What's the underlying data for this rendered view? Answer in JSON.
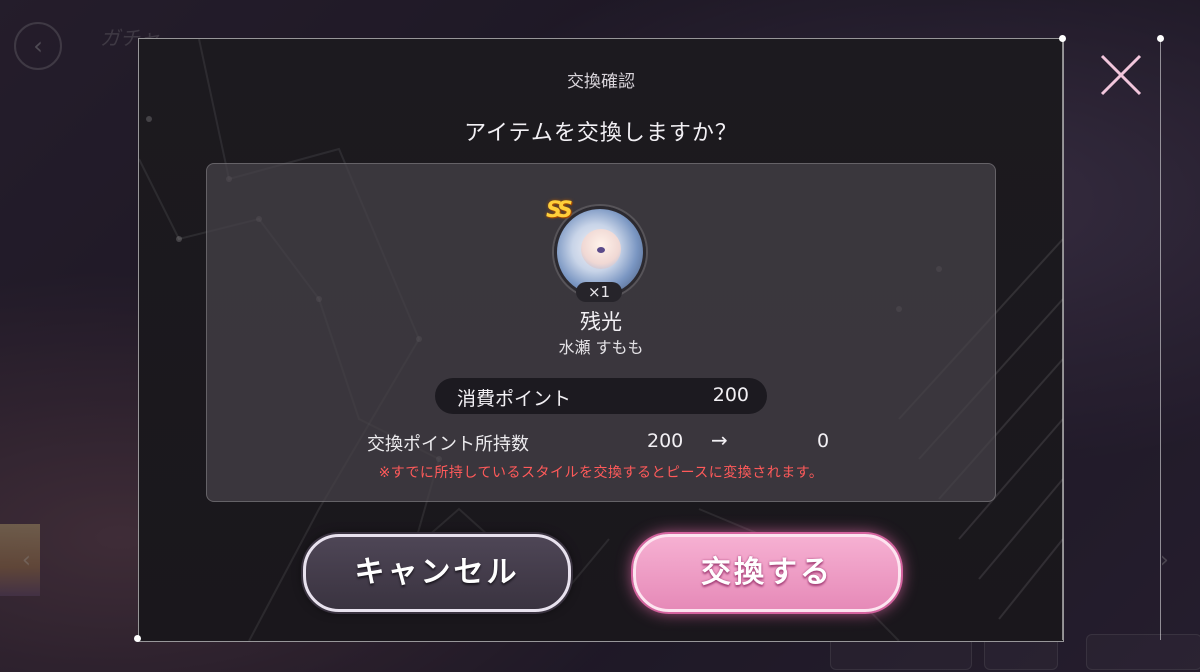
{
  "background": {
    "back_glyph": "‹",
    "screen_title": "ガチャ",
    "nav_left_glyph": "‹",
    "nav_right_glyph": "›"
  },
  "dialog": {
    "title": "交換確認",
    "question": "アイテムを交換しますか？",
    "item": {
      "rarity": "SS",
      "quantity": "×1",
      "name": "残光",
      "character": "水瀬 すもも"
    },
    "cost": {
      "label": "消費ポイント",
      "value": "200"
    },
    "holdings": {
      "label": "交換ポイント所持数",
      "before": "200",
      "arrow": "→",
      "after": "0"
    },
    "notice": "※すでに所持しているスタイルを交換するとピースに変換されます。",
    "buttons": {
      "cancel": "キャンセル",
      "confirm": "交換する"
    },
    "close_icon": "close-icon"
  },
  "colors": {
    "confirm_button": "#e68ab8",
    "cancel_button": "#3a3340",
    "notice_text": "#ff5a5a",
    "rarity_badge": "#ffcf3a"
  }
}
